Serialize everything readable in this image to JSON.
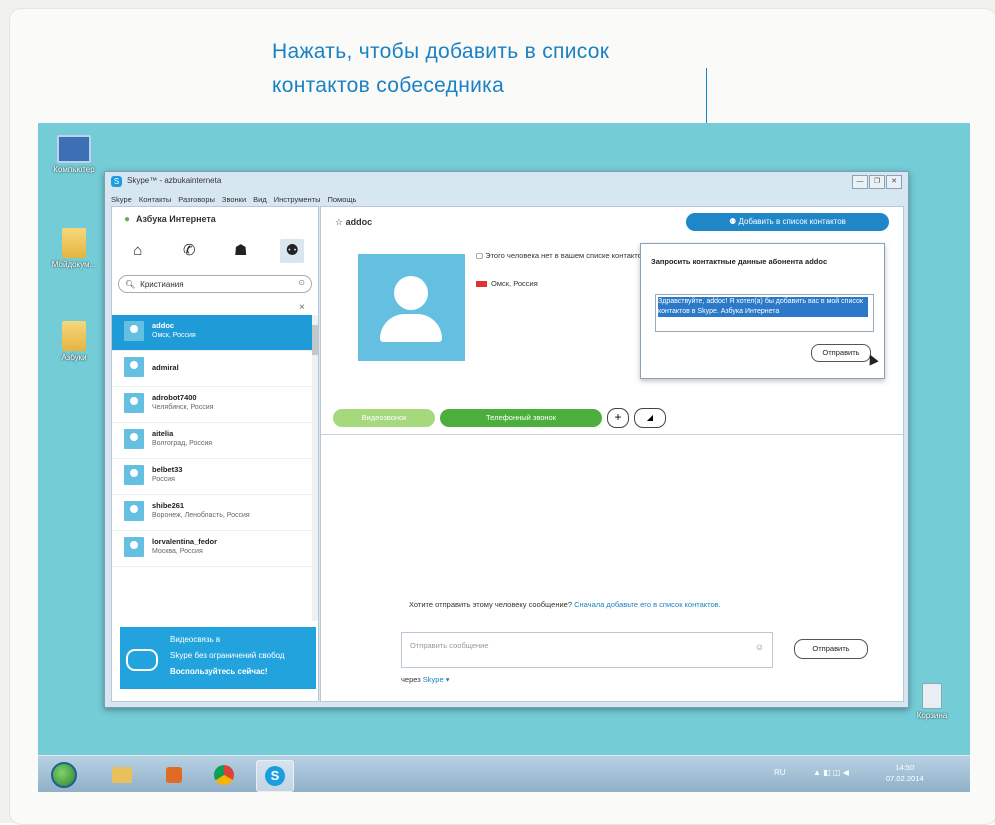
{
  "caption": {
    "line1": "Нажать, чтобы добавить в список",
    "line2": "контактов собеседника"
  },
  "desktop": {
    "icons": [
      {
        "label": "Компьютер",
        "icon": "computer-icon"
      },
      {
        "label": "Мойдокум...",
        "icon": "folder-icon"
      },
      {
        "label": "Азбуки",
        "icon": "folder-icon"
      },
      {
        "label": "Корзина",
        "icon": "recycle-bin-icon"
      }
    ]
  },
  "window": {
    "title": "Skype™ - azbukainterneta",
    "controls": [
      "—",
      "❐",
      "✕"
    ],
    "menu": [
      "Skype",
      "Контакты",
      "Разговоры",
      "Звонки",
      "Вид",
      "Инструменты",
      "Помощь"
    ]
  },
  "left": {
    "account_name": "Азбука Интернета",
    "status_icon": "●",
    "tab_icons": [
      "home-icon",
      "phone-icon",
      "contacts-icon",
      "add-contact-icon"
    ],
    "tab_glyphs": [
      "⌂",
      "✆",
      "☗",
      "⚉"
    ],
    "search_value": "Кристиания",
    "search_clear": "⊙",
    "clear_x": "×",
    "contacts": [
      {
        "name": "addoc",
        "location": "Омск, Россия"
      },
      {
        "name": "admiral",
        "location": ""
      },
      {
        "name": "adrobot7400",
        "location": "Челябинск, Россия"
      },
      {
        "name": "aitelia",
        "location": "Волгоград, Россия"
      },
      {
        "name": "belbet33",
        "location": "Россия"
      },
      {
        "name": "shibe261",
        "location": "Воронеж, Ленобласть, Россия"
      },
      {
        "name": "lorvalentina_fedor",
        "location": "Москва, Россия"
      }
    ],
    "promo": {
      "line1": "Видеосвязь в",
      "line2": "Skype без ограничений свобод",
      "line3": "Воспользуйтесь сейчас!"
    }
  },
  "main": {
    "contact_name": "addoc",
    "add_button": "Добавить в список контактов",
    "notice": "Этого человека нет в вашем списке контактов",
    "location": "Омск, Россия",
    "popup": {
      "title": "Запросить контактные данные абонента addoc",
      "message": "Здравствуйте, addoc! Я хотел(а) бы добавить вас в мой список контактов в Skype. Азбука Интернета",
      "send": "Отправить"
    },
    "call": {
      "video": "Видеозвонок",
      "phone": "Телефонный звонок",
      "plus": "+",
      "signal": "◢"
    },
    "message_note": "Хотите отправить этому человеку сообщение?",
    "message_link": "Сначала добавьте его в список контактов.",
    "compose_placeholder": "Отправить сообщение",
    "emoticon": "☺",
    "send_button": "Отправить",
    "via_label": "через",
    "via_value": "Skype ▾"
  },
  "taskbar": {
    "apps": [
      "start-button",
      "explorer",
      "media-player",
      "chrome",
      "skype"
    ],
    "tray_lang": "RU",
    "tray_icons": "▲ ◧ ◫ ◀",
    "clock_time": "14:50",
    "clock_date": "07.02.2014"
  },
  "colors": {
    "accent": "#1a82c4",
    "desktop": "#74ccd6",
    "selection": "#1f9bd7",
    "call_green": "#4cae3d"
  }
}
